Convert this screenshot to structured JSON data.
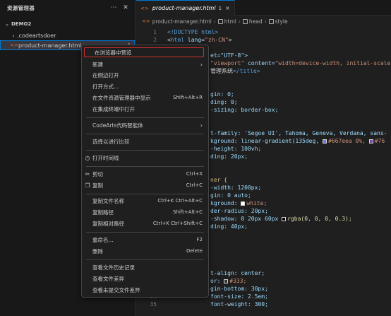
{
  "sidebar": {
    "title": "资源管理器",
    "more_icon": "ellipsis-icon",
    "close_icon": "close-icon",
    "section": "DEMO2",
    "items": [
      {
        "name": ".codeartsdoer",
        "type": "folder"
      },
      {
        "name": "product-manager.html",
        "type": "html",
        "badge": "1"
      }
    ]
  },
  "tab": {
    "label": "product-manager.html",
    "badge": "1",
    "close": "×"
  },
  "breadcrumb": [
    "product-manager.html",
    "html",
    "head",
    "style"
  ],
  "code": {
    "l1": "<!DOCTYPE html>",
    "l2_tag": "html",
    "l2_attr": "lang",
    "l2_val": "\"zh-CN\"",
    "l4": "et=\"UTF-8\">",
    "l5_a": "\"viewport\"",
    "l5_b": " content=",
    "l5_c": "\"width=device-width, initial-scale",
    "l6_a": "管理系统",
    "l6_b": "</title>",
    "l9": "gin: 0;",
    "l10": "ding: 0;",
    "l11": "-sizing: border-box;",
    "l14": "t-family: 'Segoe UI', Tahoma, Geneva, Verdana, sans-",
    "l15_a": "kground: linear-gradient(135deg, ",
    "l15_b": "#667eea 0%, ",
    "l15_c": "#76",
    "l16": "-height: 100vh;",
    "l17": "ding: 20px;",
    "l20": "ner {",
    "l21": "-width: 1200px;",
    "l22": "gin: 0 auto;",
    "l23": "kground: ",
    "l23_b": "white;",
    "l24": "der-radius: 20px;",
    "l25": "-shadow: 0 20px 60px ",
    "l25_b": "rgba(0, 0, 0, 0.3);",
    "l26": "ding: 40px;",
    "l31": "t-align: center;",
    "l32": "or: ",
    "l32_b": "#333;",
    "l33": "gin-bottom: 30px;",
    "l34_num": "34",
    "l34": "font-size: 2.5em;",
    "l35_num": "35",
    "l35": "font-weight: 300;",
    "ln1": "1",
    "ln2": "2",
    "ln3": "3"
  },
  "menu": {
    "open_browser": "在浏览器中预览",
    "new": "新建",
    "open_side": "在侧边打开",
    "open_with": "打开方式...",
    "reveal": "在文件资源管理器中显示",
    "reveal_kb": "Shift+Alt+R",
    "open_terminal": "在集成终端中打开",
    "codearts": "CodeArts代码智能体",
    "select_compare": "选择以进行比较",
    "timeline": "打开时间线",
    "cut": "剪切",
    "cut_kb": "Ctrl+X",
    "copy": "复制",
    "copy_kb": "Ctrl+C",
    "copy_name": "复制文件名称",
    "copy_name_kb": "Ctrl+K Ctrl+Alt+C",
    "copy_path": "复制路径",
    "copy_path_kb": "Shift+Alt+C",
    "copy_rel": "复制相对路径",
    "copy_rel_kb": "Ctrl+K Ctrl+Shift+C",
    "rename": "重命名...",
    "rename_kb": "F2",
    "delete": "删除",
    "delete_kb": "Delete",
    "history": "查看文件历史记录",
    "diff": "查看文件差异",
    "uncommitted": "查看未提交文件差异"
  },
  "colors": {
    "highlight_border": "#d02d2d",
    "accent": "#0078d4",
    "html_icon": "#e37933"
  }
}
